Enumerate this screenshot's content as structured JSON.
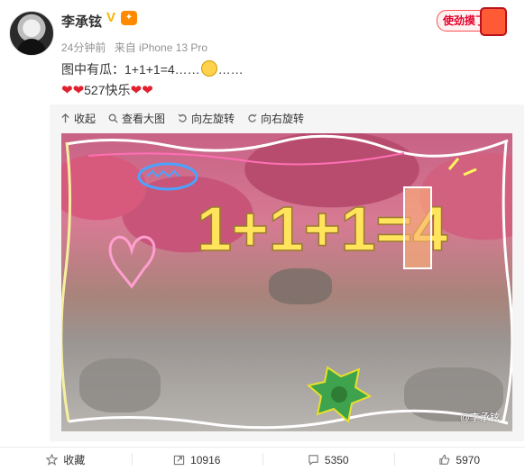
{
  "user": {
    "name": "李承铉",
    "time": "24分钟前",
    "source": "来自 iPhone 13 Pro"
  },
  "sticker_text": "使劲摸了",
  "post": {
    "line1_prefix": "图中有瓜：1+1+1=4……",
    "line1_suffix": "……",
    "line2_hearts_left": "❤❤",
    "line2_text": "527快乐",
    "line2_hearts_right": "❤❤"
  },
  "media_toolbar": {
    "collapse": "收起",
    "view_large": "查看大图",
    "rotate_left": "向左旋转",
    "rotate_right": "向右旋转"
  },
  "photo": {
    "doodle_equation": "1+1+1=4",
    "watermark": "@李承铉"
  },
  "footer": {
    "favorite": "收藏",
    "repost_count": "10916",
    "comment_count": "5350",
    "like_count": "5970"
  },
  "colors": {
    "accent": "#e0202e",
    "meta_gray": "#939393",
    "verified": "#f7b500"
  }
}
